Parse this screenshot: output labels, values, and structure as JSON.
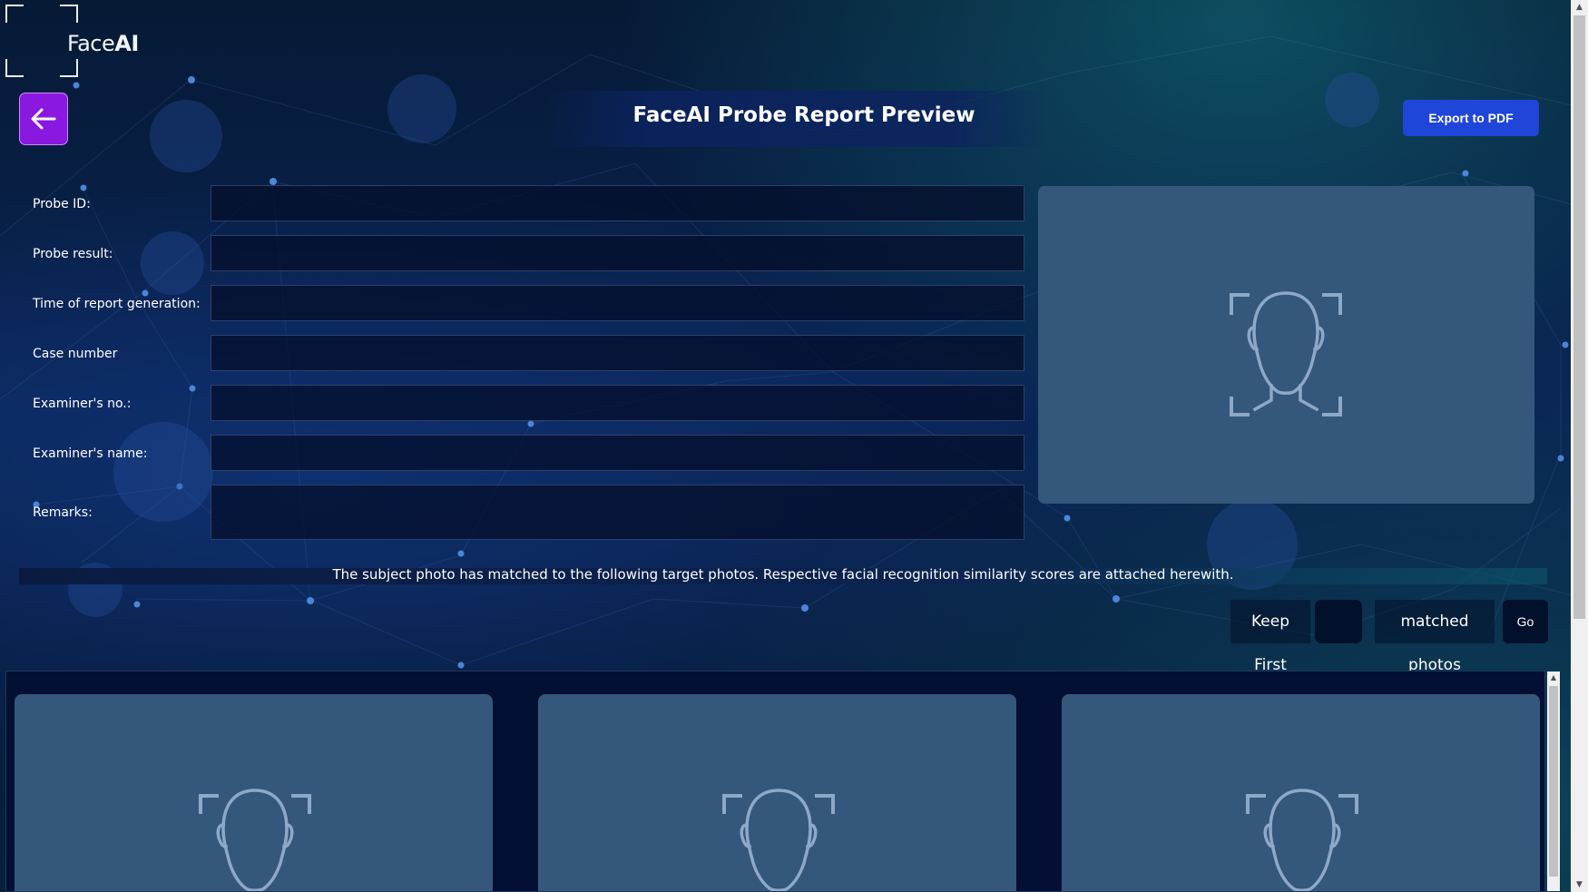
{
  "app": {
    "logo_prefix": "Face",
    "logo_suffix": "AI"
  },
  "header": {
    "title": "FaceAI Probe Report Preview",
    "export_label": "Export to PDF"
  },
  "form": {
    "probe_id_label": "Probe ID:",
    "probe_id_value": "",
    "probe_result_label": "Probe result:",
    "probe_result_value": "",
    "time_label": "Time of report generation:",
    "time_value": "",
    "case_number_label": "Case number",
    "case_number_value": "",
    "examiner_no_label": "Examiner's no.:",
    "examiner_no_value": "",
    "examiner_name_label": "Examiner's name:",
    "examiner_name_value": "",
    "remarks_label": "Remarks:",
    "remarks_value": ""
  },
  "matches": {
    "statement": "The subject photo has matched to the following target photos. Respective facial recognition similarity scores are attached herewith.",
    "keep_first_label": "Keep First",
    "keep_first_value": "",
    "matched_photos_label": "matched photos",
    "go_label": "Go"
  },
  "icons": {
    "back": "arrow-left-icon",
    "probe_photo": "face-placeholder-icon",
    "result_photo": "face-placeholder-icon"
  },
  "colors": {
    "back_button": "#8a18e0",
    "export_button": "#1f45d9",
    "photo_placeholder": "#35577c"
  }
}
